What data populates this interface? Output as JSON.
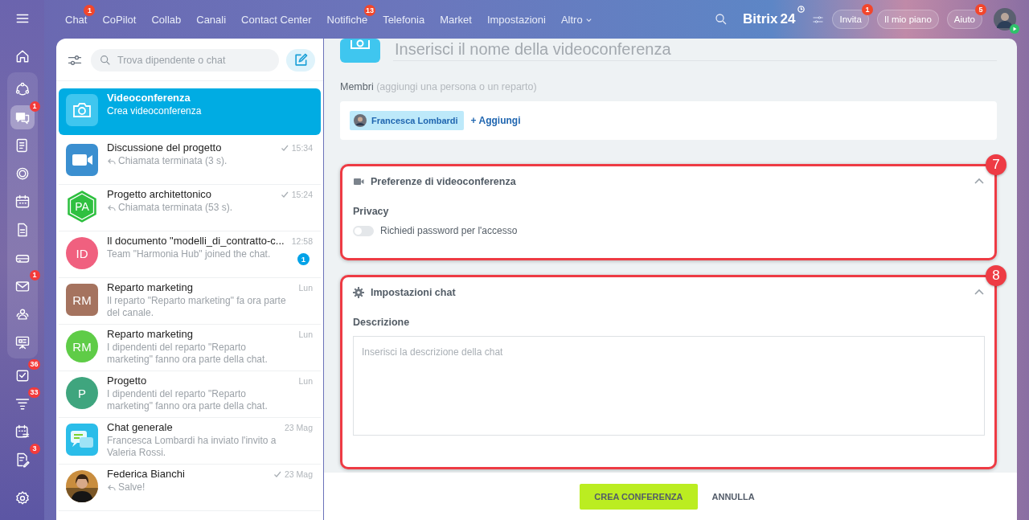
{
  "sidebar": {
    "top_items": [
      {
        "kind": "home",
        "selected": false
      }
    ],
    "pinned_group": [
      {
        "kind": "flow",
        "selected": false
      },
      {
        "kind": "chat",
        "selected": true,
        "badge": "1"
      },
      {
        "kind": "feed",
        "selected": false
      },
      {
        "kind": "ring",
        "selected": false
      },
      {
        "kind": "calendar",
        "selected": false
      },
      {
        "kind": "doc",
        "selected": false
      },
      {
        "kind": "drive",
        "selected": false
      },
      {
        "kind": "mail",
        "selected": false,
        "badge": "1"
      },
      {
        "kind": "people",
        "selected": false
      },
      {
        "kind": "board",
        "selected": false
      }
    ],
    "more_items": [
      {
        "kind": "tasks",
        "selected": false,
        "badge": "36"
      },
      {
        "kind": "funnel",
        "selected": false,
        "badge": "33"
      },
      {
        "kind": "schedule",
        "selected": false
      },
      {
        "kind": "signdoc",
        "selected": false,
        "badge": "3"
      }
    ]
  },
  "top_nav": [
    {
      "label": "Chat",
      "kind": "link",
      "badge": "1"
    },
    {
      "label": "CoPilot",
      "kind": "link"
    },
    {
      "label": "Collab",
      "kind": "link"
    },
    {
      "label": "Canali",
      "kind": "link"
    },
    {
      "label": "Contact Center",
      "kind": "link"
    },
    {
      "label": "Notifiche",
      "kind": "link",
      "badge": "13"
    },
    {
      "label": "Telefonia",
      "kind": "link"
    },
    {
      "label": "Market",
      "kind": "link"
    },
    {
      "label": "Impostazioni",
      "kind": "link"
    },
    {
      "label": "Altro",
      "kind": "menu"
    }
  ],
  "logo": {
    "name": "Bitrix",
    "number": "24"
  },
  "header_buttons": [
    {
      "label": "Invita",
      "badge": "1"
    },
    {
      "label": "Il mio piano"
    },
    {
      "label": "Aiuto",
      "badge": "5"
    }
  ],
  "chat_list": {
    "search": {
      "placeholder": "Trova dipendente o chat"
    },
    "chats": [
      {
        "title": "Videoconferenza",
        "preview": "Crea videoconferenza",
        "selected": true,
        "avatar": {
          "kind": "camera"
        }
      },
      {
        "title": "Discussione del progetto",
        "preview": "Chiamata terminata (3 s).",
        "time": "15:34",
        "read": true,
        "outgoing": true,
        "selected": false,
        "avatar": {
          "kind": "video"
        }
      },
      {
        "title": "Progetto architettonico",
        "preview": "Chiamata terminata (53 s).",
        "time": "15:24",
        "read": true,
        "outgoing": true,
        "selected": false,
        "avatar": {
          "kind": "hexagon",
          "initials": "PA",
          "color": "#2fc040"
        }
      },
      {
        "title": "Il documento \"modelli_di_contratto-c...",
        "preview": "Team \"Harmonia Hub\" joined the chat.",
        "time": "12:58",
        "unread": "1",
        "selected": false,
        "avatar": {
          "kind": "circle",
          "initials": "ID",
          "color": "#f0607f"
        }
      },
      {
        "title": "Reparto marketing",
        "preview": "Il reparto \"Reparto marketing\" fa ora parte del canale.",
        "time": "Lun",
        "selected": false,
        "avatar": {
          "kind": "square",
          "initials": "RM",
          "color": "#a5735f"
        }
      },
      {
        "title": "Reparto marketing",
        "preview": "I dipendenti del reparto \"Reparto marketing\" fanno ora parte della chat.",
        "time": "Lun",
        "selected": false,
        "avatar": {
          "kind": "circle",
          "initials": "RM",
          "color": "#5fcc47"
        }
      },
      {
        "title": "Progetto",
        "preview": "I dipendenti del reparto \"Reparto marketing\" fanno ora parte della chat.",
        "time": "Lun",
        "selected": false,
        "avatar": {
          "kind": "circle",
          "initials": "P",
          "color": "#3fa57e"
        }
      },
      {
        "title": "Chat generale",
        "preview": "Francesca Lombardi ha inviato l'invito a Valeria Rossi.",
        "time": "23 Mag",
        "selected": false,
        "avatar": {
          "kind": "general"
        }
      },
      {
        "title": "Federica Bianchi",
        "preview": "Salve!",
        "time": "23 Mag",
        "read": true,
        "outgoing": true,
        "selected": false
      }
    ]
  },
  "conference_form": {
    "title_field": {
      "placeholder": "Inserisci il nome della videoconferenza"
    },
    "members": {
      "label": "Membri",
      "hint": "(aggiungi una persona o un reparto)",
      "chips": [
        {
          "name": "Francesca Lombardi"
        }
      ],
      "add_link": "+ Aggiungi"
    },
    "sections": [
      {
        "kind": "video",
        "title": "Preferenze di videoconferenza",
        "expanded": true,
        "callout": "7",
        "fields": [
          {
            "kind": "toggle",
            "group_label": "Privacy",
            "label": "Richiedi password per l'accesso",
            "on": false
          }
        ]
      },
      {
        "kind": "settings",
        "title": "Impostazioni chat",
        "expanded": true,
        "callout": "8",
        "fields": [
          {
            "kind": "textarea",
            "group_label": "Descrizione",
            "placeholder": "Inserisci la descrizione della chat"
          }
        ]
      }
    ],
    "buttons": [
      {
        "label": "CREA CONFERENZA",
        "kind": "primary"
      },
      {
        "label": "ANNULLA",
        "kind": "plain"
      }
    ]
  }
}
